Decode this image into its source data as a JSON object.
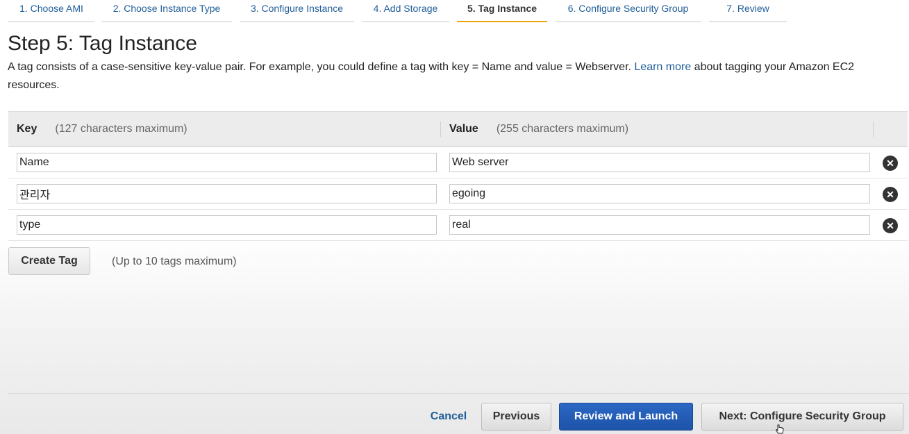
{
  "wizard": {
    "steps": [
      {
        "label": "1. Choose AMI"
      },
      {
        "label": "2. Choose Instance Type"
      },
      {
        "label": "3. Configure Instance"
      },
      {
        "label": "4. Add Storage"
      },
      {
        "label": "5. Tag Instance",
        "active": true
      },
      {
        "label": "6. Configure Security Group"
      },
      {
        "label": "7. Review"
      }
    ]
  },
  "page": {
    "title": "Step 5: Tag Instance",
    "description_before": "A tag consists of a case-sensitive key-value pair. For example, you could define a tag with key = Name and value = Webserver. ",
    "learn_more": "Learn more",
    "description_after": " about tagging your Amazon EC2 resources."
  },
  "table": {
    "key_header": "Key",
    "key_hint": "(127 characters maximum)",
    "value_header": "Value",
    "value_hint": "(255 characters maximum)",
    "rows": [
      {
        "key": "Name",
        "value": "Web server"
      },
      {
        "key": "관리자",
        "value": "egoing"
      },
      {
        "key": "type",
        "value": "real"
      }
    ],
    "remove_icon": "close-circle-icon"
  },
  "actions": {
    "create_tag": "Create Tag",
    "create_hint": "(Up to 10 tags maximum)"
  },
  "footer": {
    "cancel": "Cancel",
    "previous": "Previous",
    "review_launch": "Review and Launch",
    "next": "Next: Configure Security Group"
  },
  "colors": {
    "link": "#1f5d99",
    "active_tab_underline": "#f0a30a",
    "primary_button": "#2b68c5"
  }
}
